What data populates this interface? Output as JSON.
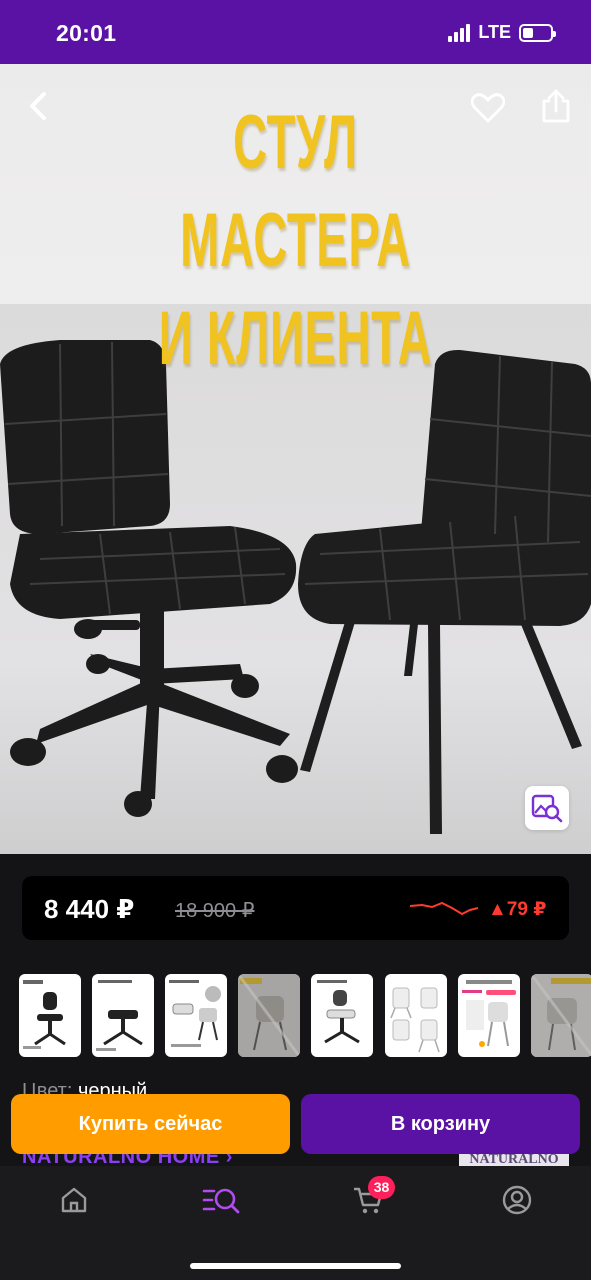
{
  "status_bar": {
    "time": "20:01",
    "network": "LTE"
  },
  "hero": {
    "title_line1": "СТУЛ МАСТЕРА",
    "title_line2": "И КЛИЕНТА",
    "icons": [
      "back-arrow-icon",
      "heart-icon",
      "share-icon",
      "image-search-icon"
    ]
  },
  "price": {
    "current": "8 440 ₽",
    "old": "18 900 ₽",
    "change": "▲79 ₽",
    "change_color": "#ff3b30"
  },
  "thumbnails": [
    {
      "name": "thumb-1"
    },
    {
      "name": "thumb-2"
    },
    {
      "name": "thumb-3"
    },
    {
      "name": "thumb-4"
    },
    {
      "name": "thumb-5"
    },
    {
      "name": "thumb-6"
    },
    {
      "name": "thumb-7"
    },
    {
      "name": "thumb-8"
    }
  ],
  "product": {
    "color_label": "Цвет:",
    "color_value": "черный",
    "brand": "NATURALNO HOME ›",
    "brand_logo": "NATURALNO"
  },
  "actions": {
    "buy_now": "Купить сейчас",
    "add_to_cart": "В корзину"
  },
  "tab_bar": {
    "cart_badge": "38",
    "tabs": [
      "home-icon",
      "catalog-search-icon",
      "cart-icon",
      "profile-icon"
    ],
    "accent": "#b04cf0"
  },
  "colors": {
    "brand_purple": "#5a12a4",
    "buy_orange": "#ff9d00"
  }
}
